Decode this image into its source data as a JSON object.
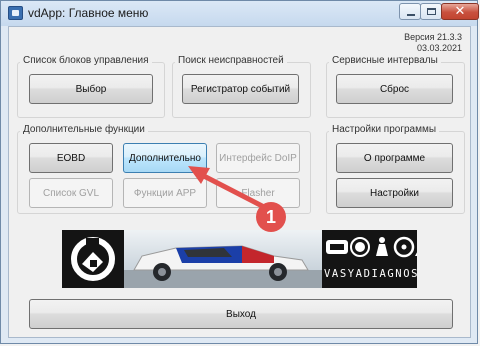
{
  "window": {
    "title": "vdApp:  Главное меню",
    "controls": {
      "minimize_icon": "minimize-icon",
      "maximize_icon": "maximize-icon",
      "close_icon": "close-icon",
      "close_glyph": "✕"
    }
  },
  "version": {
    "line1": "Версия 21.3.3",
    "line2": "03.03.2021"
  },
  "groups": {
    "control_units": {
      "label": "Список блоков управления",
      "button": "Выбор"
    },
    "fault_search": {
      "label": "Поиск неисправностей",
      "button": "Регистратор событий"
    },
    "service": {
      "label": "Сервисные интервалы",
      "button": "Сброс"
    },
    "extra": {
      "label": "Дополнительные функции",
      "buttons": [
        "EOBD",
        "Дополнительно",
        "Интерфейс DoIP",
        "Список GVL",
        "Функции APP",
        "Flasher"
      ]
    },
    "settings": {
      "label": "Настройки программы",
      "about": "О программе",
      "settings": "Настройки"
    }
  },
  "banner": {
    "site": "VASYADIAGNOST.COM"
  },
  "annotation": {
    "step": "1"
  },
  "exit_button": "Выход",
  "colors": {
    "accent": "#3c7fb1",
    "annotation": "#e2504d",
    "close": "#c24430"
  }
}
